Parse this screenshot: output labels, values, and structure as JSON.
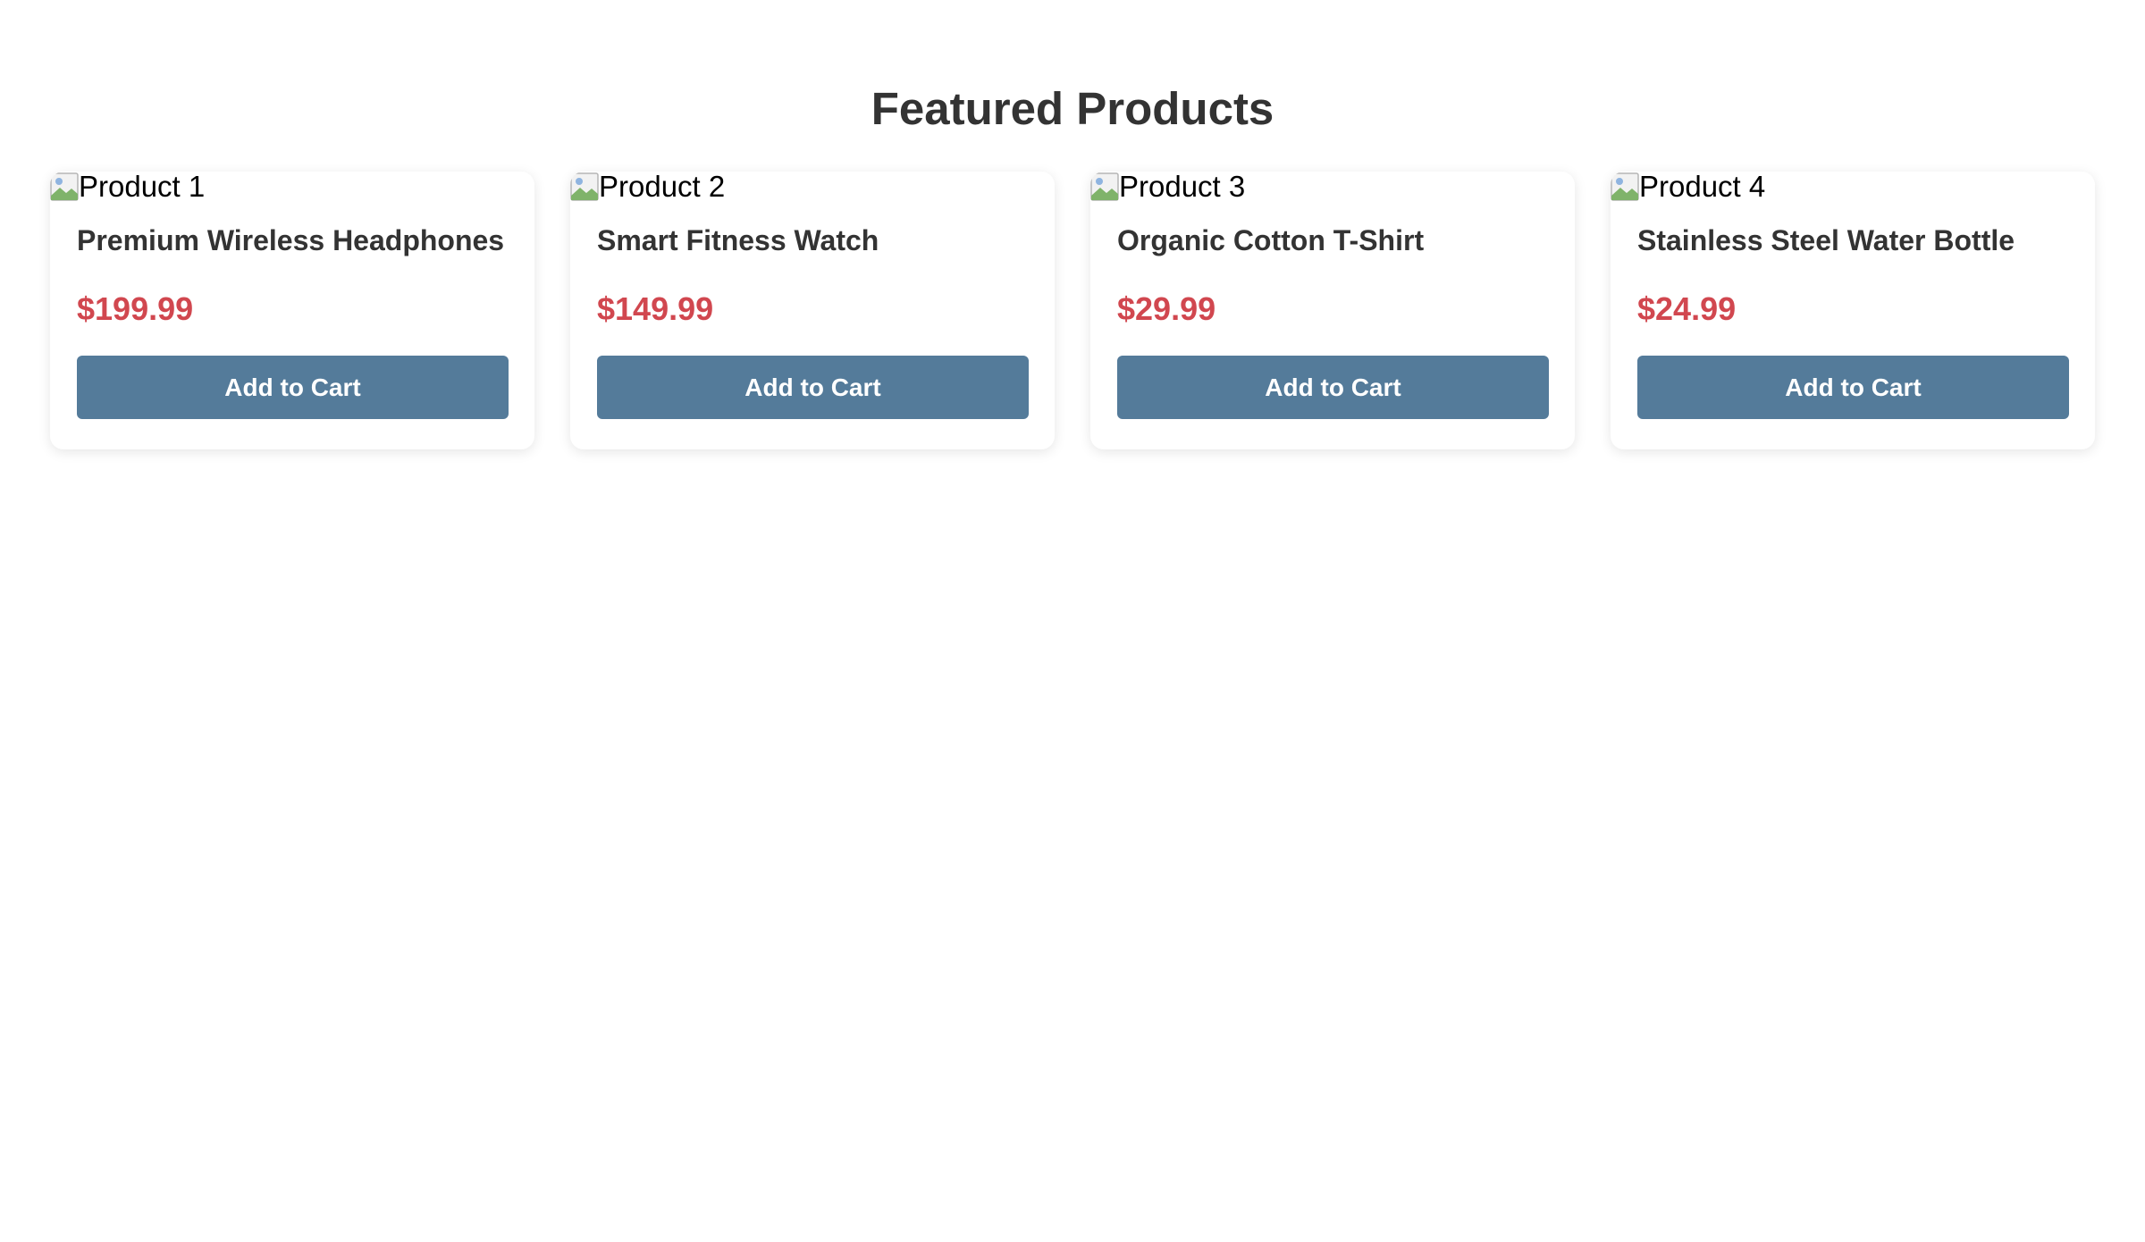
{
  "header": {
    "title": "Featured Products"
  },
  "products": [
    {
      "image_alt": "Product 1",
      "name": "Premium Wireless Headphones",
      "price": "$199.99",
      "button_label": "Add to Cart"
    },
    {
      "image_alt": "Product 2",
      "name": "Smart Fitness Watch",
      "price": "$149.99",
      "button_label": "Add to Cart"
    },
    {
      "image_alt": "Product 3",
      "name": "Organic Cotton T-Shirt",
      "price": "$29.99",
      "button_label": "Add to Cart"
    },
    {
      "image_alt": "Product 4",
      "name": "Stainless Steel Water Bottle",
      "price": "$24.99",
      "button_label": "Add to Cart"
    }
  ],
  "colors": {
    "title": "#333333",
    "price": "#d1474f",
    "button": "#547b9a",
    "button_text": "#ffffff"
  },
  "icons": {
    "image_placeholder": "broken-image-icon"
  }
}
